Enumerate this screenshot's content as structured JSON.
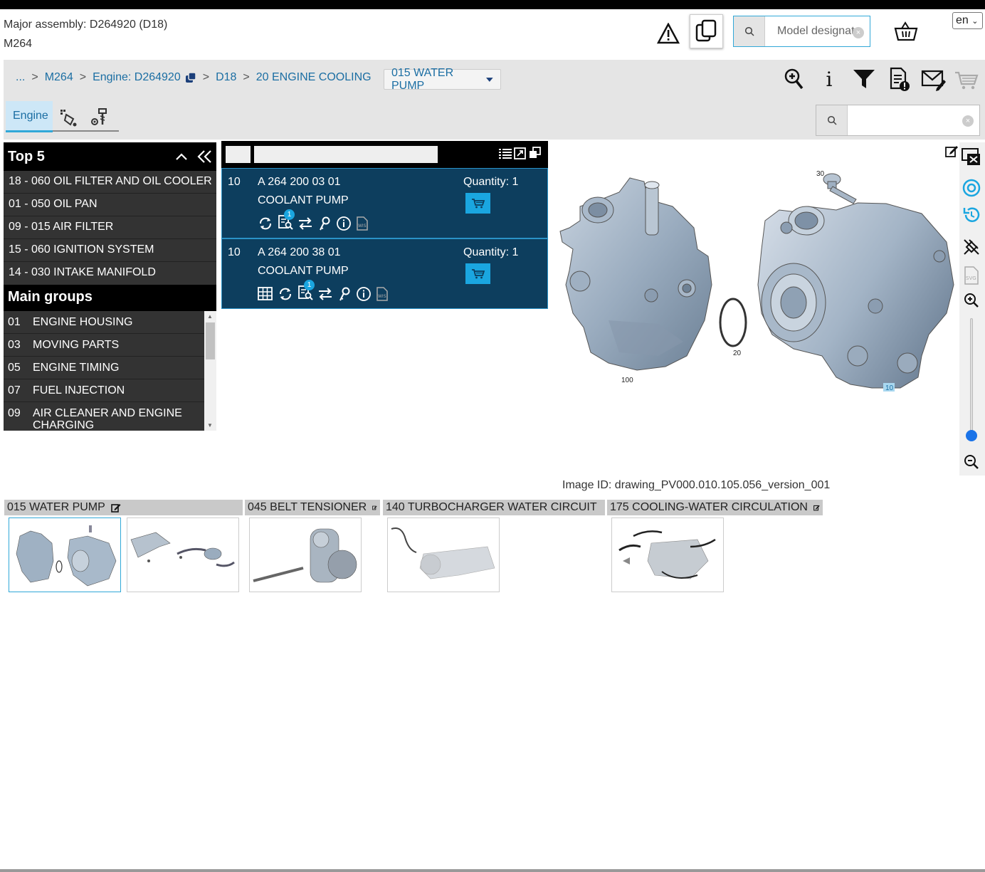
{
  "header": {
    "major_assembly": "Major assembly: D264920 (D18)",
    "model": "M264",
    "search_placeholder": "Model designat",
    "lang": "en"
  },
  "breadcrumb": {
    "ellipsis": "...",
    "items": [
      "M264",
      "Engine: D264920",
      "D18",
      "20 ENGINE COOLING"
    ],
    "separator": ">",
    "dropdown": "015 WATER PUMP"
  },
  "tabs": {
    "engine": "Engine"
  },
  "top5": {
    "title": "Top 5",
    "items": [
      "18 - 060 OIL FILTER AND OIL COOLER",
      "01 - 050 OIL PAN",
      "09 - 015 AIR FILTER",
      "15 - 060 IGNITION SYSTEM",
      "14 - 030 INTAKE MANIFOLD"
    ]
  },
  "main_groups": {
    "title": "Main groups",
    "items": [
      {
        "num": "01",
        "label": "ENGINE HOUSING"
      },
      {
        "num": "03",
        "label": "MOVING PARTS"
      },
      {
        "num": "05",
        "label": "ENGINE TIMING"
      },
      {
        "num": "07",
        "label": "FUEL INJECTION"
      },
      {
        "num": "09",
        "label": "AIR CLEANER AND ENGINE"
      },
      {
        "num": "",
        "label": "CHARGING"
      }
    ]
  },
  "parts": [
    {
      "pos": "10",
      "number": "A 264 200 03 01",
      "name": "COOLANT PUMP",
      "qty": "Quantity: 1",
      "badge": "1"
    },
    {
      "pos": "10",
      "number": "A 264 200 38 01",
      "name": "COOLANT PUMP",
      "qty": "Quantity: 1",
      "badge": "1"
    }
  ],
  "drawing": {
    "callouts": [
      "30",
      "20",
      "100",
      "10"
    ],
    "image_id": "Image ID: drawing_PV000.010.105.056_version_001"
  },
  "categories": [
    "015 WATER PUMP",
    "045 BELT TENSIONER",
    "140 TURBOCHARGER WATER CIRCUIT",
    "175 COOLING-WATER CIRCULATION"
  ],
  "colors": {
    "accent": "#31a8d8",
    "part_bg": "#0d3e5e",
    "link": "#1b6ea3"
  }
}
